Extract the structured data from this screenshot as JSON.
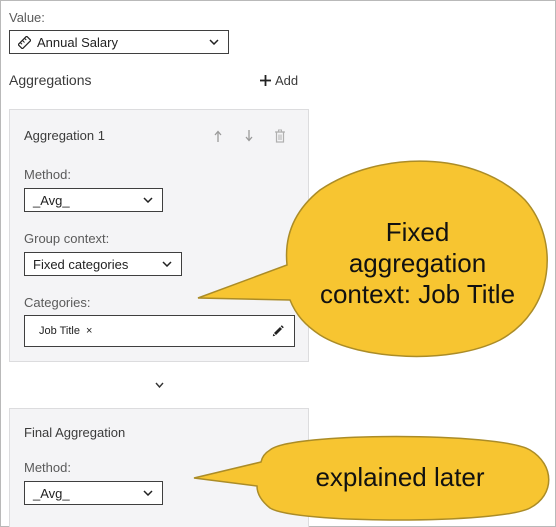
{
  "value_section": {
    "label": "Value:",
    "selected": "Annual Salary",
    "icon": "measure-tag-icon"
  },
  "aggregations": {
    "heading": "Aggregations",
    "add_label": "Add"
  },
  "aggregation1": {
    "title": "Aggregation 1",
    "method_label": "Method:",
    "method_value": "_Avg_",
    "group_context_label": "Group context:",
    "group_context_value": "Fixed categories",
    "categories_label": "Categories:",
    "category_token": "Job Title",
    "token_remove": "×"
  },
  "final_aggregation": {
    "title": "Final Aggregation",
    "method_label": "Method:",
    "method_value": "_Avg_"
  },
  "callouts": {
    "fixed_context": [
      "Fixed",
      "aggregation",
      "context: Job Title"
    ],
    "explained_later": "explained later",
    "fill_color": "#f7c531",
    "stroke_color": "#ab8c27"
  },
  "colors": {
    "panel_bg": "#f4f4f6",
    "border": "#3f3f3f",
    "label": "#5a5a5a"
  }
}
